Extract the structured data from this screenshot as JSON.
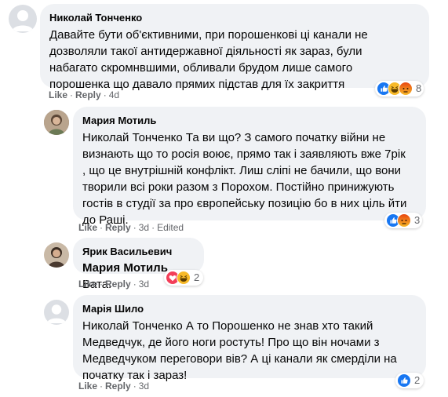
{
  "comments": [
    {
      "author": "Николай Тонченко",
      "text": "Давайте бути об'єктивними, при порошенкові ці канали не\nдозволяли такої антидержавної діяльності як зараз, були\nнабагато скромнвшими, обливали брудом лише самого\nпорошенка що давало прямих підстав для їх закриття",
      "actions": {
        "like": "Like",
        "reply": "Reply",
        "time": "4d"
      },
      "reactions": {
        "icons": [
          "like",
          "haha",
          "angry"
        ],
        "count": "8"
      }
    },
    {
      "author": "Мария Мотиль",
      "text": "Николай Тонченко Та ви що? З самого початку війни не\nвизнають що то росія воює, прямо так і заявляють вже 7рік\n, що це внутрішній конфлікт. Лиш сліпі не бачили, що вони\nтворили всі роки разом з Порохом. Постійно принижують\nгостів в студії за про європейську позицію бо в них ціль йти\nдо Раші.",
      "actions": {
        "like": "Like",
        "reply": "Reply",
        "time": "3d",
        "edited": "Edited"
      },
      "reactions": {
        "icons": [
          "like",
          "angry"
        ],
        "count": "3"
      }
    },
    {
      "author": "Ярик Васильевич",
      "mention": "Мария Мотиль",
      "text": "Вата.",
      "actions": {
        "like": "Like",
        "reply": "Reply",
        "time": "3d"
      },
      "reactions": {
        "icons": [
          "love",
          "haha"
        ],
        "count": "2"
      }
    },
    {
      "author": "Марія Шило",
      "text": "Николай Тонченко А то Порошенко не знав хто такий\nМедведчук, де його ноги ростуть! Про що він ночами з\nМедведчуком переговори вів? А ці канали як смердiли на\nпочатку так і зараз!",
      "actions": {
        "like": "Like",
        "reply": "Reply",
        "time": "3d"
      },
      "reactions": {
        "icons": [
          "like"
        ],
        "count": "2"
      }
    }
  ],
  "colors": {
    "like": "#1877f2",
    "love": "#f33e58",
    "haha": "#f7b928",
    "angry": "#e9710f",
    "bubble": "#f0f2f5",
    "meta": "#65676b"
  }
}
